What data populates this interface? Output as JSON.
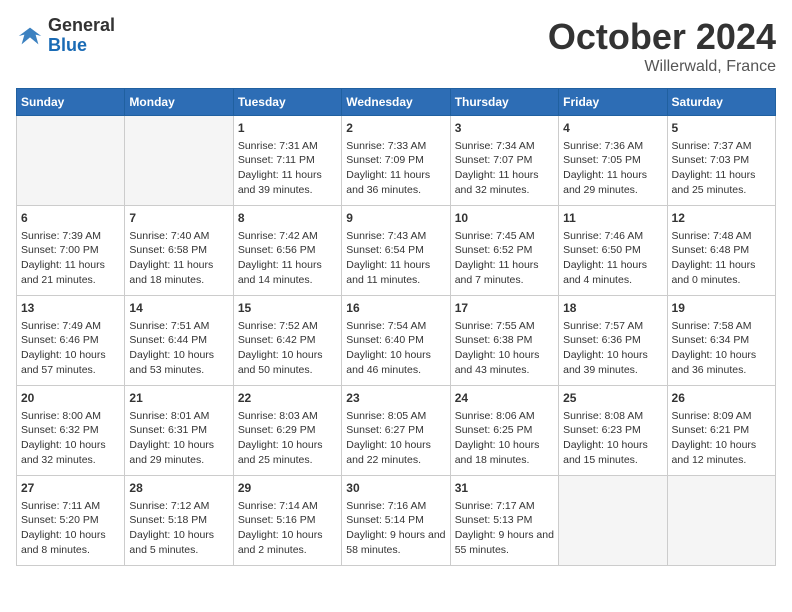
{
  "header": {
    "logo_line1": "General",
    "logo_line2": "Blue",
    "month": "October 2024",
    "location": "Willerwald, France"
  },
  "days_of_week": [
    "Sunday",
    "Monday",
    "Tuesday",
    "Wednesday",
    "Thursday",
    "Friday",
    "Saturday"
  ],
  "weeks": [
    [
      {
        "day": "",
        "empty": true
      },
      {
        "day": "",
        "empty": true
      },
      {
        "day": "1",
        "sunrise": "Sunrise: 7:31 AM",
        "sunset": "Sunset: 7:11 PM",
        "daylight": "Daylight: 11 hours and 39 minutes."
      },
      {
        "day": "2",
        "sunrise": "Sunrise: 7:33 AM",
        "sunset": "Sunset: 7:09 PM",
        "daylight": "Daylight: 11 hours and 36 minutes."
      },
      {
        "day": "3",
        "sunrise": "Sunrise: 7:34 AM",
        "sunset": "Sunset: 7:07 PM",
        "daylight": "Daylight: 11 hours and 32 minutes."
      },
      {
        "day": "4",
        "sunrise": "Sunrise: 7:36 AM",
        "sunset": "Sunset: 7:05 PM",
        "daylight": "Daylight: 11 hours and 29 minutes."
      },
      {
        "day": "5",
        "sunrise": "Sunrise: 7:37 AM",
        "sunset": "Sunset: 7:03 PM",
        "daylight": "Daylight: 11 hours and 25 minutes."
      }
    ],
    [
      {
        "day": "6",
        "sunrise": "Sunrise: 7:39 AM",
        "sunset": "Sunset: 7:00 PM",
        "daylight": "Daylight: 11 hours and 21 minutes."
      },
      {
        "day": "7",
        "sunrise": "Sunrise: 7:40 AM",
        "sunset": "Sunset: 6:58 PM",
        "daylight": "Daylight: 11 hours and 18 minutes."
      },
      {
        "day": "8",
        "sunrise": "Sunrise: 7:42 AM",
        "sunset": "Sunset: 6:56 PM",
        "daylight": "Daylight: 11 hours and 14 minutes."
      },
      {
        "day": "9",
        "sunrise": "Sunrise: 7:43 AM",
        "sunset": "Sunset: 6:54 PM",
        "daylight": "Daylight: 11 hours and 11 minutes."
      },
      {
        "day": "10",
        "sunrise": "Sunrise: 7:45 AM",
        "sunset": "Sunset: 6:52 PM",
        "daylight": "Daylight: 11 hours and 7 minutes."
      },
      {
        "day": "11",
        "sunrise": "Sunrise: 7:46 AM",
        "sunset": "Sunset: 6:50 PM",
        "daylight": "Daylight: 11 hours and 4 minutes."
      },
      {
        "day": "12",
        "sunrise": "Sunrise: 7:48 AM",
        "sunset": "Sunset: 6:48 PM",
        "daylight": "Daylight: 11 hours and 0 minutes."
      }
    ],
    [
      {
        "day": "13",
        "sunrise": "Sunrise: 7:49 AM",
        "sunset": "Sunset: 6:46 PM",
        "daylight": "Daylight: 10 hours and 57 minutes."
      },
      {
        "day": "14",
        "sunrise": "Sunrise: 7:51 AM",
        "sunset": "Sunset: 6:44 PM",
        "daylight": "Daylight: 10 hours and 53 minutes."
      },
      {
        "day": "15",
        "sunrise": "Sunrise: 7:52 AM",
        "sunset": "Sunset: 6:42 PM",
        "daylight": "Daylight: 10 hours and 50 minutes."
      },
      {
        "day": "16",
        "sunrise": "Sunrise: 7:54 AM",
        "sunset": "Sunset: 6:40 PM",
        "daylight": "Daylight: 10 hours and 46 minutes."
      },
      {
        "day": "17",
        "sunrise": "Sunrise: 7:55 AM",
        "sunset": "Sunset: 6:38 PM",
        "daylight": "Daylight: 10 hours and 43 minutes."
      },
      {
        "day": "18",
        "sunrise": "Sunrise: 7:57 AM",
        "sunset": "Sunset: 6:36 PM",
        "daylight": "Daylight: 10 hours and 39 minutes."
      },
      {
        "day": "19",
        "sunrise": "Sunrise: 7:58 AM",
        "sunset": "Sunset: 6:34 PM",
        "daylight": "Daylight: 10 hours and 36 minutes."
      }
    ],
    [
      {
        "day": "20",
        "sunrise": "Sunrise: 8:00 AM",
        "sunset": "Sunset: 6:32 PM",
        "daylight": "Daylight: 10 hours and 32 minutes."
      },
      {
        "day": "21",
        "sunrise": "Sunrise: 8:01 AM",
        "sunset": "Sunset: 6:31 PM",
        "daylight": "Daylight: 10 hours and 29 minutes."
      },
      {
        "day": "22",
        "sunrise": "Sunrise: 8:03 AM",
        "sunset": "Sunset: 6:29 PM",
        "daylight": "Daylight: 10 hours and 25 minutes."
      },
      {
        "day": "23",
        "sunrise": "Sunrise: 8:05 AM",
        "sunset": "Sunset: 6:27 PM",
        "daylight": "Daylight: 10 hours and 22 minutes."
      },
      {
        "day": "24",
        "sunrise": "Sunrise: 8:06 AM",
        "sunset": "Sunset: 6:25 PM",
        "daylight": "Daylight: 10 hours and 18 minutes."
      },
      {
        "day": "25",
        "sunrise": "Sunrise: 8:08 AM",
        "sunset": "Sunset: 6:23 PM",
        "daylight": "Daylight: 10 hours and 15 minutes."
      },
      {
        "day": "26",
        "sunrise": "Sunrise: 8:09 AM",
        "sunset": "Sunset: 6:21 PM",
        "daylight": "Daylight: 10 hours and 12 minutes."
      }
    ],
    [
      {
        "day": "27",
        "sunrise": "Sunrise: 7:11 AM",
        "sunset": "Sunset: 5:20 PM",
        "daylight": "Daylight: 10 hours and 8 minutes."
      },
      {
        "day": "28",
        "sunrise": "Sunrise: 7:12 AM",
        "sunset": "Sunset: 5:18 PM",
        "daylight": "Daylight: 10 hours and 5 minutes."
      },
      {
        "day": "29",
        "sunrise": "Sunrise: 7:14 AM",
        "sunset": "Sunset: 5:16 PM",
        "daylight": "Daylight: 10 hours and 2 minutes."
      },
      {
        "day": "30",
        "sunrise": "Sunrise: 7:16 AM",
        "sunset": "Sunset: 5:14 PM",
        "daylight": "Daylight: 9 hours and 58 minutes."
      },
      {
        "day": "31",
        "sunrise": "Sunrise: 7:17 AM",
        "sunset": "Sunset: 5:13 PM",
        "daylight": "Daylight: 9 hours and 55 minutes."
      },
      {
        "day": "",
        "empty": true
      },
      {
        "day": "",
        "empty": true
      }
    ]
  ]
}
